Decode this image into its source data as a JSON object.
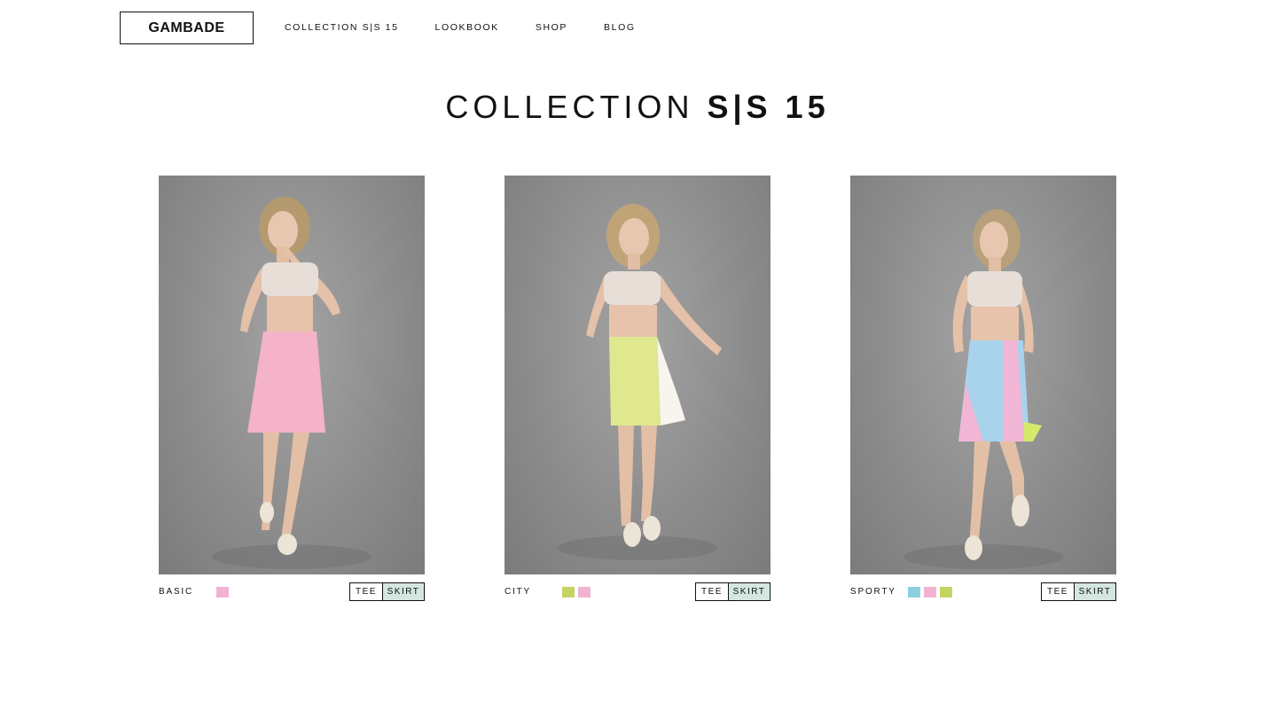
{
  "header": {
    "logo": "GAMBADE",
    "nav": [
      "COLLECTION S|S 15",
      "LOOKBOOK",
      "SHOP",
      "BLOG"
    ]
  },
  "main": {
    "title_light": "COLLECTION",
    "title_strong": "S|S 15"
  },
  "products": [
    {
      "name": "BASIC",
      "swatches": [
        "#f2b3d3"
      ],
      "options": [
        "TEE",
        "SKIRT"
      ],
      "skirt_colors": [
        "#f4b3c8"
      ]
    },
    {
      "name": "CITY",
      "swatches": [
        "#c5d460",
        "#f2b3d3"
      ],
      "options": [
        "TEE",
        "SKIRT"
      ],
      "skirt_colors": [
        "#dfe88f",
        "#f8f4ee"
      ]
    },
    {
      "name": "SPORTY",
      "swatches": [
        "#8fd0e0",
        "#f2b3d3",
        "#c5d460"
      ],
      "options": [
        "TEE",
        "SKIRT"
      ],
      "skirt_colors": [
        "#a9d3ec",
        "#f1b6d6",
        "#d6ea6a"
      ]
    }
  ],
  "colors": {
    "toggle_active": "#d4e6e0",
    "backdrop": "#8f8f8f"
  }
}
